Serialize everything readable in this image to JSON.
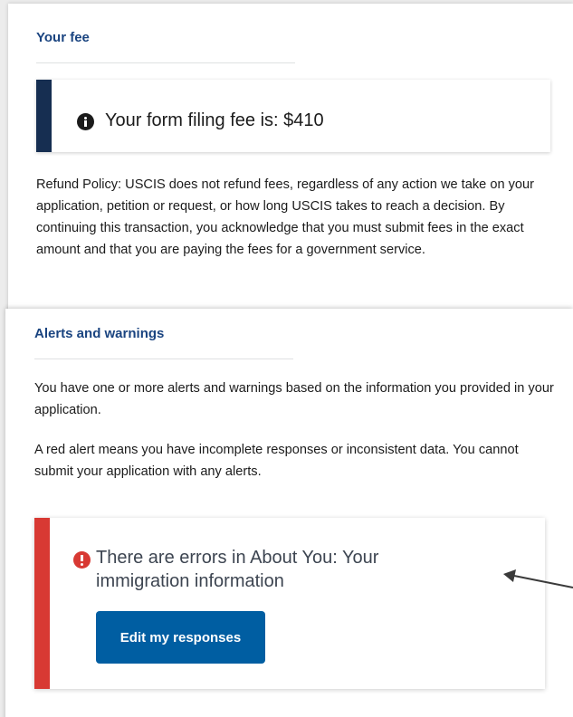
{
  "fee_section": {
    "title": "Your fee",
    "fee_message": "Your form filing fee is: $410",
    "refund_policy": "Refund Policy: USCIS does not refund fees, regardless of any action we take on your application, petition or request, or how long USCIS takes to reach a decision. By continuing this transaction, you acknowledge that you must submit fees in the exact amount and that you are paying the fees for a government service."
  },
  "alerts_section": {
    "title": "Alerts and warnings",
    "paragraph_1": "You have one or more alerts and warnings based on the information you provided in your application.",
    "paragraph_2": "A red alert means you have incomplete responses or inconsistent data. You cannot submit your application with any alerts.",
    "error_alert": {
      "message": "There are errors in About You: Your immigration information",
      "button_label": "Edit my responses"
    }
  },
  "colors": {
    "heading_blue": "#1a4480",
    "info_accent": "#162e51",
    "error_accent": "#d83933",
    "button_blue": "#005ea2"
  },
  "icons": {
    "fee_icon": "info-circle-icon",
    "error_icon": "exclamation-circle-icon",
    "annotation": "arrow-left-icon"
  }
}
